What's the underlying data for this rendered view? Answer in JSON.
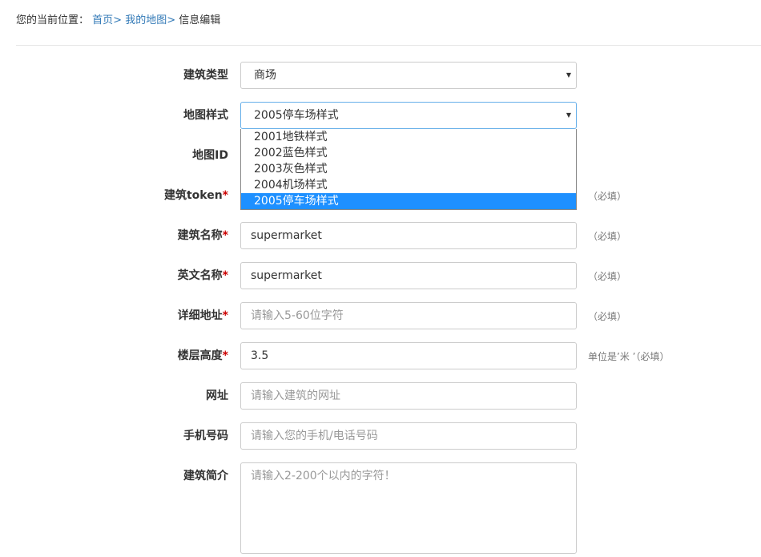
{
  "breadcrumb": {
    "prefix": "您的当前位置：",
    "home": "首页",
    "sep": ">",
    "maps": "我的地图",
    "current": "信息编辑"
  },
  "form": {
    "building_type": {
      "label": "建筑类型",
      "value": "商场"
    },
    "map_style": {
      "label": "地图样式",
      "value": "2005停车场样式",
      "options": [
        "2001地铁样式",
        "2002蓝色样式",
        "2003灰色样式",
        "2004机场样式",
        "2005停车场样式"
      ],
      "selected_index": 4
    },
    "map_id": {
      "label": "地图ID"
    },
    "token": {
      "label": "建筑token",
      "required": "*",
      "hint": "（必填）"
    },
    "name": {
      "label": "建筑名称",
      "required": "*",
      "value": "supermarket",
      "hint": "（必填）"
    },
    "en_name": {
      "label": "英文名称",
      "required": "*",
      "value": "supermarket",
      "hint": "（必填）"
    },
    "address": {
      "label": "详细地址",
      "required": "*",
      "placeholder": "请输入5-60位字符",
      "hint": "（必填）"
    },
    "floor_height": {
      "label": "楼层高度",
      "required": "*",
      "value": "3.5",
      "hint": "单位是’米 ’（必填）"
    },
    "website": {
      "label": "网址",
      "placeholder": "请输入建筑的网址"
    },
    "phone": {
      "label": "手机号码",
      "placeholder": "请输入您的手机/电话号码"
    },
    "intro": {
      "label": "建筑简介",
      "placeholder": "请输入2-200个以内的字符！"
    }
  },
  "icons": {
    "caret": "caret-down-icon"
  },
  "colors": {
    "link": "#337ab7",
    "required": "#cc0000",
    "selected_option": "#1e90ff",
    "focus_border": "#66afe9"
  }
}
